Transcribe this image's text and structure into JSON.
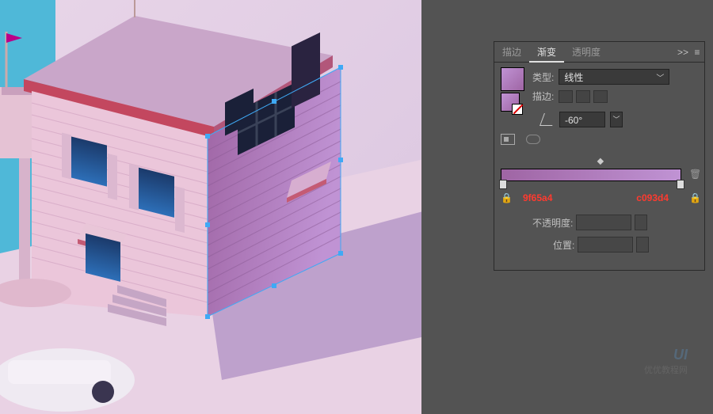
{
  "tabs": {
    "stroke": "描边",
    "gradient": "渐变",
    "transparency": "透明度",
    "expand": ">>"
  },
  "gradient": {
    "type_label": "类型:",
    "type_value": "线性",
    "stroke_label": "描边:",
    "angle_value": "-60°",
    "opacity_label": "不透明度:",
    "location_label": "位置:",
    "stop_left_hex": "9f65a4",
    "stop_right_hex": "c093d4"
  },
  "watermark": {
    "logo": "UI",
    "text": "优优教程网"
  },
  "colors": {
    "grad_from": "#9f65a4",
    "grad_to": "#c093d4"
  }
}
